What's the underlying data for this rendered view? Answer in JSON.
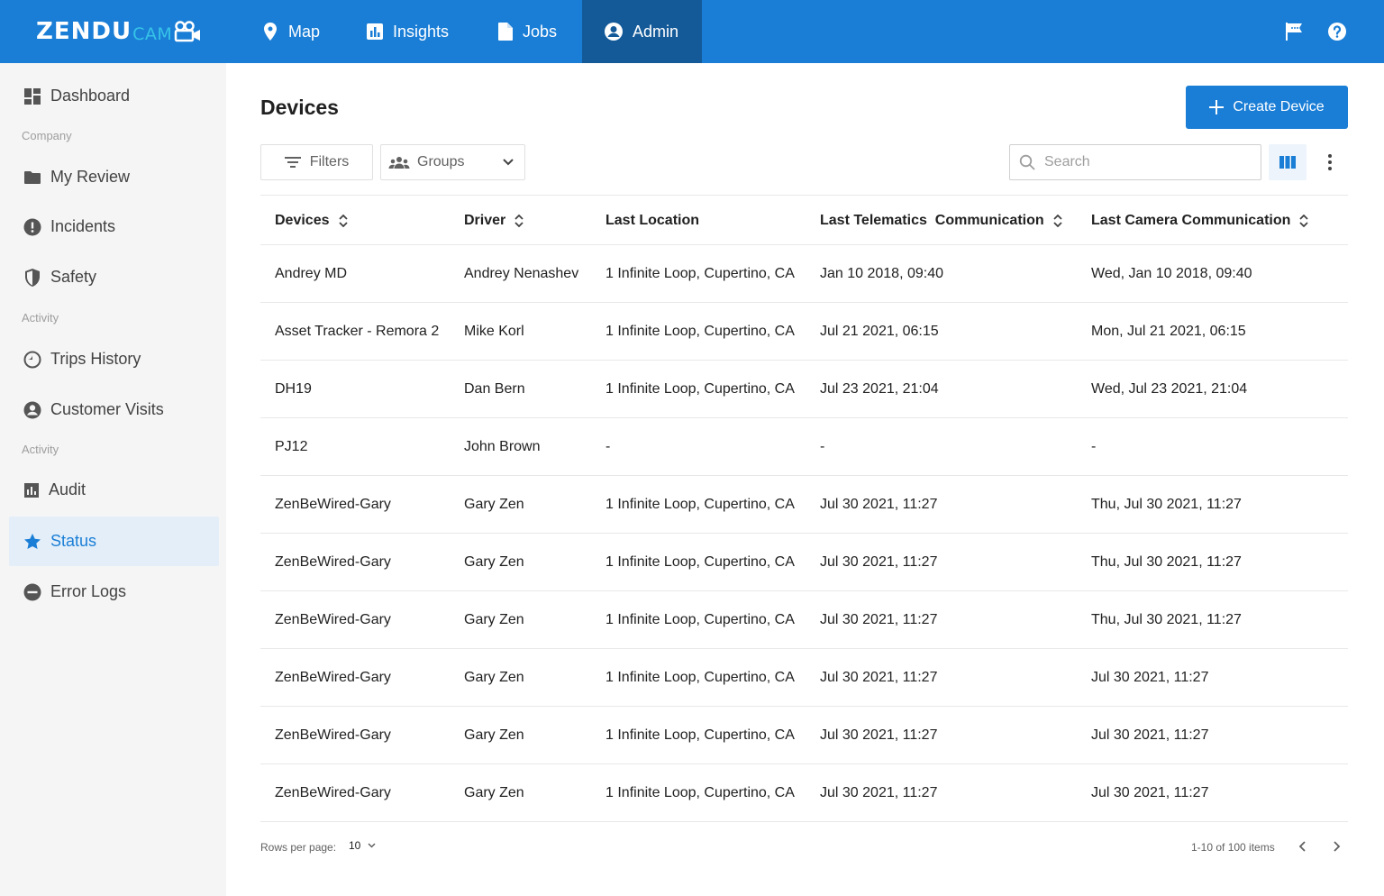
{
  "brand": {
    "logo_main": "ZENDU",
    "logo_sub": "CAM"
  },
  "nav": [
    {
      "label": "Map",
      "icon": "map-pin-icon"
    },
    {
      "label": "Insights",
      "icon": "chart-icon"
    },
    {
      "label": "Jobs",
      "icon": "document-icon"
    },
    {
      "label": "Admin",
      "icon": "user-circle-icon",
      "active": true
    }
  ],
  "topbar_icons": [
    "flag-icon",
    "help-icon"
  ],
  "sidebar": {
    "dashboard": "Dashboard",
    "section_company": "Company",
    "my_review": "My Review",
    "incidents": "Incidents",
    "safety": "Safety",
    "section_activity_1": "Activity",
    "trips_history": "Trips History",
    "customer_visits": "Customer Visits",
    "section_activity_2": "Activity",
    "audit": "Audit",
    "status": "Status",
    "error_logs": "Error Logs"
  },
  "page": {
    "title": "Devices",
    "create_label": "Create Device"
  },
  "toolbar": {
    "filters_label": "Filters",
    "groups_label": "Groups",
    "search_placeholder": "Search"
  },
  "table": {
    "headers": [
      "Devices",
      "Driver",
      "Last Location",
      "Last Telematics  Communication",
      "Last Camera Communication"
    ],
    "rows": [
      [
        "Andrey MD",
        "Andrey Nenashev",
        "1 Infinite Loop, Cupertino, CA",
        "Jan 10 2018, 09:40",
        "Wed, Jan 10 2018, 09:40"
      ],
      [
        "Asset Tracker - Remora 2",
        "Mike Korl",
        "1 Infinite Loop, Cupertino, CA",
        "Jul 21 2021, 06:15",
        "Mon, Jul 21 2021, 06:15"
      ],
      [
        "DH19",
        "Dan Bern",
        "1 Infinite Loop, Cupertino, CA",
        "Jul 23 2021, 21:04",
        "Wed, Jul 23 2021, 21:04"
      ],
      [
        "PJ12",
        "John Brown",
        "-",
        "-",
        "-"
      ],
      [
        "ZenBeWired-Gary",
        "Gary Zen",
        "1 Infinite Loop, Cupertino, CA",
        "Jul 30 2021, 11:27",
        "Thu, Jul 30 2021, 11:27"
      ],
      [
        "ZenBeWired-Gary",
        "Gary Zen",
        "1 Infinite Loop, Cupertino, CA",
        "Jul 30 2021, 11:27",
        "Thu, Jul 30 2021, 11:27"
      ],
      [
        "ZenBeWired-Gary",
        "Gary Zen",
        "1 Infinite Loop, Cupertino, CA",
        "Jul 30 2021, 11:27",
        "Thu, Jul 30 2021, 11:27"
      ],
      [
        "ZenBeWired-Gary",
        "Gary Zen",
        "1 Infinite Loop, Cupertino, CA",
        "Jul 30 2021, 11:27",
        "Jul 30 2021, 11:27"
      ],
      [
        "ZenBeWired-Gary",
        "Gary Zen",
        "1 Infinite Loop, Cupertino, CA",
        "Jul 30 2021, 11:27",
        "Jul 30 2021, 11:27"
      ],
      [
        "ZenBeWired-Gary",
        "Gary Zen",
        "1 Infinite Loop, Cupertino, CA",
        "Jul 30 2021, 11:27",
        "Jul 30 2021, 11:27"
      ]
    ]
  },
  "pagination": {
    "rows_label": "Rows per page:",
    "rows_value": "10",
    "range_text": "1-10 of 100 items"
  },
  "colors": {
    "primary": "#1a7ed6",
    "nav_active": "#145a99",
    "logo_accent": "#36c3e8",
    "sidebar_bg": "#f5f5f5",
    "sidebar_active_bg": "#e3eef9"
  }
}
